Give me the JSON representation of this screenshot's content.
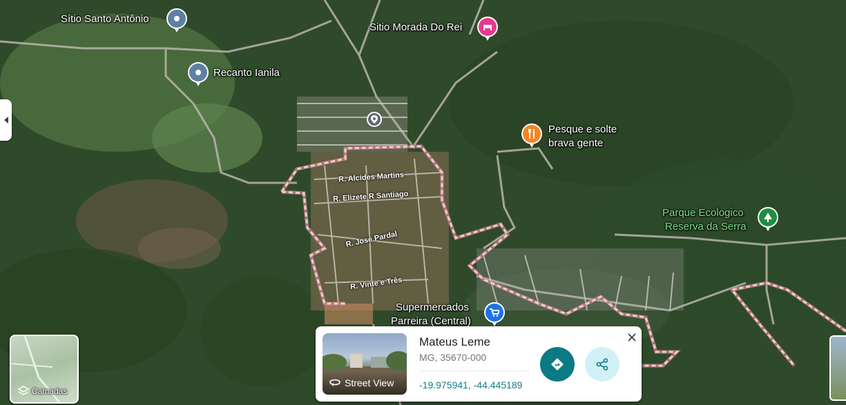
{
  "map": {
    "pois": [
      {
        "id": "sitio-santo-antonio",
        "label": "Sítio Santo Antônio",
        "type": "place"
      },
      {
        "id": "sitio-morada-do-rei",
        "label": "Sitio Morada Do Rei",
        "type": "lodging"
      },
      {
        "id": "recanto-ianila",
        "label": "Recanto Ianila",
        "type": "place"
      },
      {
        "id": "pesque-e-solte",
        "label_line1": "Pesque e solte",
        "label_line2": "brava gente",
        "type": "restaurant"
      },
      {
        "id": "parque-ecologico",
        "label_line1": "Parque Ecologico",
        "label_line2": "Reserva da Serra",
        "type": "park"
      },
      {
        "id": "supermercados-parreira",
        "label_line1": "Supermercados",
        "label_line2": "Parreira (Central)",
        "type": "shopping"
      }
    ],
    "streets": [
      "R. Alcides Martins",
      "R. Elizete R Santiago",
      "R. José Pardal",
      "R. Vinte e Três"
    ],
    "colors": {
      "place_pin": "#5f7fa3",
      "lodging_pin": "#e7398f",
      "restaurant_pin": "#f58424",
      "park_pin": "#1e8e3e",
      "shopping_pin": "#1a73e8",
      "boundary": "#f2a0a8"
    }
  },
  "layers_button": {
    "label": "Camadas"
  },
  "place_card": {
    "title": "Mateus Leme",
    "subtitle": "MG, 35670-000",
    "coordinates": "-19.975941, -44.445189",
    "street_view_label": "Street View",
    "accent": "#0b7a85"
  }
}
